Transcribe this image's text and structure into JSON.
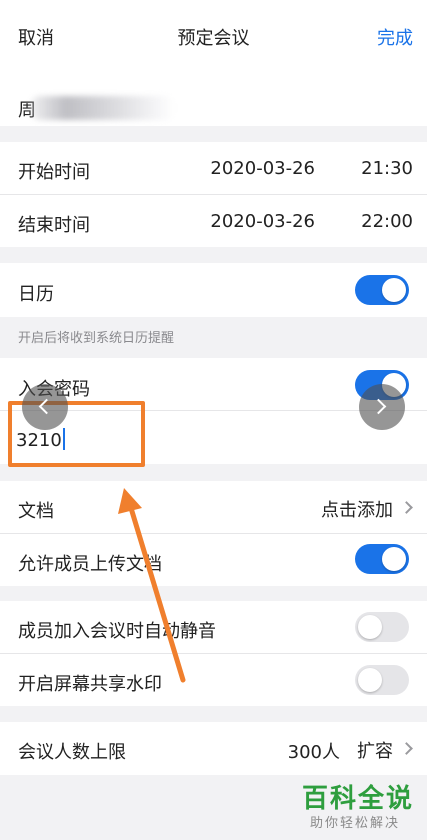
{
  "nav": {
    "cancel_label": "取消",
    "title": "预定会议",
    "done_label": "完成"
  },
  "meeting_topic": {
    "visible_char": "周"
  },
  "schedule": {
    "start_label": "开始时间",
    "start_date": "2020-03-26",
    "start_time": "21:30",
    "end_label": "结束时间",
    "end_date": "2020-03-26",
    "end_time": "22:00"
  },
  "calendar": {
    "label": "日历",
    "enabled": true,
    "hint": "开启后将收到系统日历提醒"
  },
  "password": {
    "label": "入会密码",
    "enabled": true,
    "value": "3210"
  },
  "documents": {
    "label": "文档",
    "action_label": "点击添加"
  },
  "allow_upload": {
    "label": "允许成员上传文档",
    "enabled": true
  },
  "auto_mute": {
    "label": "成员加入会议时自动静音",
    "enabled": false
  },
  "share_watermark": {
    "label": "开启屏幕共享水印",
    "enabled": false
  },
  "member_limit": {
    "label": "会议人数上限",
    "value": "300人",
    "action_label": "扩容"
  },
  "watermark": {
    "brand": "百科全说",
    "tagline": "助你轻松解决"
  },
  "colors": {
    "accent": "#1a73e8",
    "annotation": "#f07f2d",
    "toggle_off": "#e5e5e8",
    "brand_green": "#2e9e3e"
  }
}
